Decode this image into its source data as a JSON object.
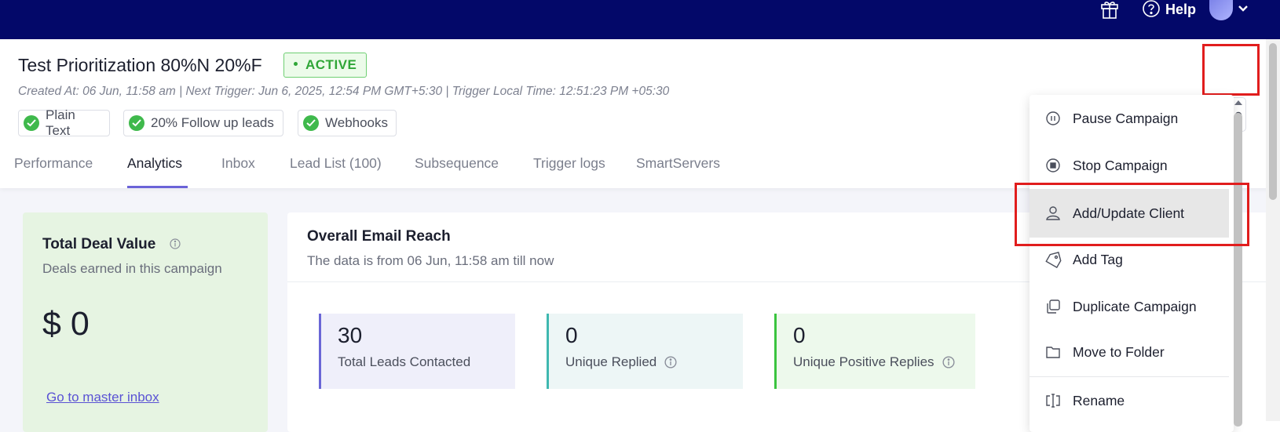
{
  "topbar": {
    "help_label": "Help",
    "icons": [
      "gift-icon",
      "help-icon",
      "avatar",
      "chevron-down-icon"
    ]
  },
  "campaign": {
    "title": "Test Prioritization 80%N 20%F",
    "status": "ACTIVE",
    "meta": "Created At: 06 Jun, 11:58 am | Next Trigger: Jun 6, 2025, 12:54 PM GMT+5:30 | Trigger Local Time: 12:51:23 PM +05:30",
    "features": [
      "Plain Text",
      "20% Follow up leads",
      "Webhooks"
    ]
  },
  "tabs": [
    "Performance",
    "Analytics",
    "Inbox",
    "Lead List (100)",
    "Subsequence",
    "Trigger logs",
    "SmartServers"
  ],
  "active_tab": "Analytics",
  "deal_card": {
    "title": "Total Deal Value",
    "subtitle": "Deals earned in this campaign",
    "value": "$ 0",
    "link": "Go to master inbox"
  },
  "reach_card": {
    "title": "Overall Email Reach",
    "subtitle": "The data is from 06 Jun, 11:58 am till now",
    "stats": [
      {
        "value": "30",
        "label": "Total Leads Contacted",
        "bg": "#efeffa",
        "accent": "#6a66d6"
      },
      {
        "value": "0",
        "label": "Unique Replied",
        "bg": "#edf6f6",
        "accent": "#3fb8b0"
      },
      {
        "value": "0",
        "label": "Unique Positive Replies",
        "bg": "#edf9ec",
        "accent": "#3ac43f"
      }
    ]
  },
  "menu": {
    "items": [
      "Pause Campaign",
      "Stop Campaign",
      "Add/Update Client",
      "Add Tag",
      "Duplicate Campaign",
      "Move to Folder",
      "Rename"
    ],
    "highlighted": "Add/Update Client"
  },
  "colors": {
    "topbar": "#030869",
    "accent": "#6b63d8",
    "active_green": "#2fa637",
    "highlight_red": "#e11d1d"
  }
}
